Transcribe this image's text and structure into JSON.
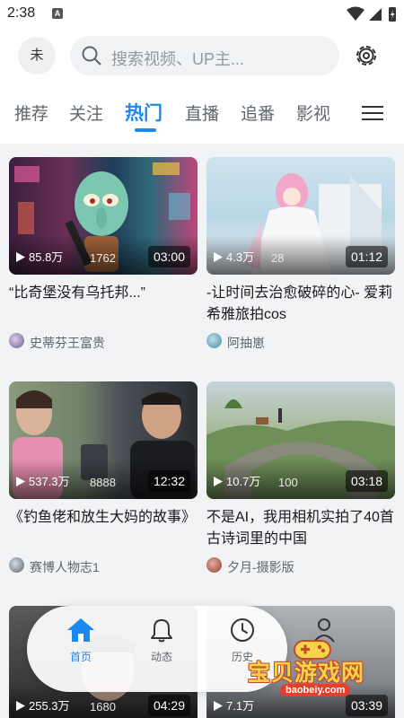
{
  "status_bar": {
    "time": "2:38",
    "notification_letter": "A"
  },
  "header": {
    "avatar_text": "未",
    "search_placeholder": "搜索视频、UP主..."
  },
  "tabs": [
    {
      "label": "推荐",
      "active": false
    },
    {
      "label": "关注",
      "active": false
    },
    {
      "label": "热门",
      "active": true
    },
    {
      "label": "直播",
      "active": false
    },
    {
      "label": "追番",
      "active": false
    },
    {
      "label": "影视",
      "active": false
    }
  ],
  "videos": [
    {
      "title": "“比奇堡没有乌托邦...”",
      "views": "85.8万",
      "comments": "1762",
      "duration": "03:00",
      "author": "史蒂芬王富贵"
    },
    {
      "title": "-让时间去治愈破碎的心- 爱莉希雅旅拍cos",
      "views": "4.3万",
      "comments": "28",
      "duration": "01:12",
      "author": "阿抽崽"
    },
    {
      "title": "《钓鱼佬和放生大妈的故事》",
      "views": "537.3万",
      "comments": "8888",
      "duration": "12:32",
      "author": "赛博人物志1"
    },
    {
      "title": "不是AI，我用相机实拍了40首古诗词里的中国",
      "views": "10.7万",
      "comments": "100",
      "duration": "03:18",
      "author": "夕月-摄影版"
    },
    {
      "title": "",
      "views": "255.3万",
      "comments": "1680",
      "duration": "04:29",
      "author": ""
    },
    {
      "title": "",
      "views": "7.1万",
      "comments": "",
      "duration": "03:39",
      "author": ""
    }
  ],
  "bottom_nav": [
    {
      "label": "首页",
      "icon": "home-icon",
      "active": true
    },
    {
      "label": "动态",
      "icon": "bell-icon",
      "active": false
    },
    {
      "label": "历史",
      "icon": "clock-icon",
      "active": false
    }
  ],
  "watermark": {
    "text": "宝贝游戏网",
    "url": "baobeiy.com"
  },
  "colors": {
    "accent": "#1a89f0",
    "background": "#f2f3f5",
    "watermark_yellow": "#f7d34a",
    "watermark_red": "#e63e2e"
  }
}
